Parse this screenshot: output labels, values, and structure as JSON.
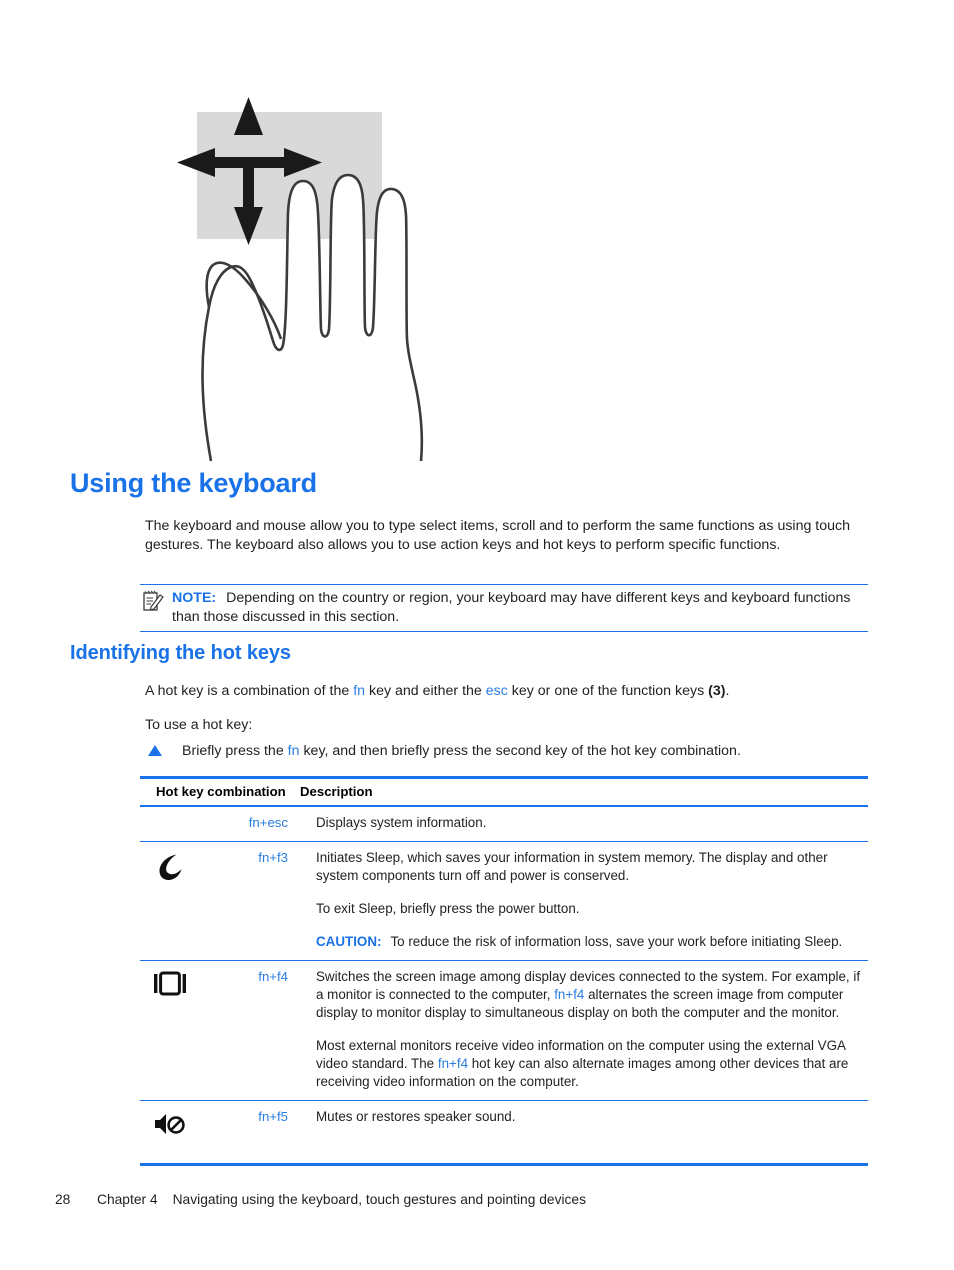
{
  "illustration": {
    "name": "hand-touchpad-scroll-gesture",
    "touchpad_color": "#d9d9d9",
    "arrow_color": "#1a1a1a",
    "description": "Hand over a touchpad with four-directional arrows"
  },
  "headings": {
    "h1": "Using the keyboard",
    "h2": "Identifying the hot keys",
    "accent_color": "#1a72e8"
  },
  "intro_paragraph": "The keyboard and mouse allow you to type select items, scroll and to perform the same functions as using touch gestures. The keyboard also allows you to use action keys and hot keys to perform specific functions.",
  "note": {
    "icon": "note-pencil-icon",
    "label": "NOTE:",
    "text": "Depending on the country or region, your keyboard may have different keys and keyboard functions than those discussed in this section."
  },
  "hotkey_definition": {
    "part1": "A hot key is a combination of the ",
    "fn": "fn",
    "part2": " key and either the ",
    "esc": "esc",
    "part3": " key or one of the function keys ",
    "ref": "(3)",
    "part4": "."
  },
  "to_use_label": "To use a hot key:",
  "step": {
    "marker": "triangle-bullet",
    "part1": "Briefly press the ",
    "fn": "fn",
    "part2": " key, and then briefly press the second key of the hot key combination."
  },
  "table": {
    "headers": {
      "key": "Hot key combination",
      "description": "Description"
    },
    "rows": [
      {
        "icon": "none",
        "key_fn": "fn",
        "key_plus": "+",
        "key_second": "esc",
        "paragraphs": [
          {
            "type": "plain",
            "text": "Displays system information."
          }
        ]
      },
      {
        "icon": "moon-icon",
        "key_fn": "fn",
        "key_plus": "+",
        "key_second": "f3",
        "paragraphs": [
          {
            "type": "plain",
            "text": "Initiates Sleep, which saves your information in system memory. The display and other system components turn off and power is conserved."
          },
          {
            "type": "plain",
            "text": "To exit Sleep, briefly press the power button."
          },
          {
            "type": "caution",
            "label": "CAUTION:",
            "text": "To reduce the risk of information loss, save your work before initiating Sleep."
          }
        ]
      },
      {
        "icon": "display-switch-icon",
        "key_fn": "fn",
        "key_plus": "+",
        "key_second": "f4",
        "paragraphs": [
          {
            "type": "rich1",
            "a": "Switches the screen image among display devices connected to the system. For example, if a monitor is connected to the computer, ",
            "fn": "fn",
            "plus": "+",
            "f4": "f4",
            "b": " alternates the screen image from computer display to monitor display to simultaneous display on both the computer and the monitor."
          },
          {
            "type": "rich2",
            "a": "Most external monitors receive video information on the computer using the external VGA video standard. The ",
            "fn": "fn",
            "plus": "+",
            "f4": "f4",
            "b": " hot key can also alternate images among other devices that are receiving video information on the computer."
          }
        ]
      },
      {
        "icon": "mute-speaker-icon",
        "key_fn": "fn",
        "key_plus": "+",
        "key_second": "f5",
        "paragraphs": [
          {
            "type": "plain",
            "text": "Mutes or restores speaker sound."
          }
        ]
      }
    ]
  },
  "footer": {
    "page_number": "28",
    "chapter": "Chapter 4",
    "title": "Navigating using the keyboard, touch gestures and pointing devices"
  }
}
